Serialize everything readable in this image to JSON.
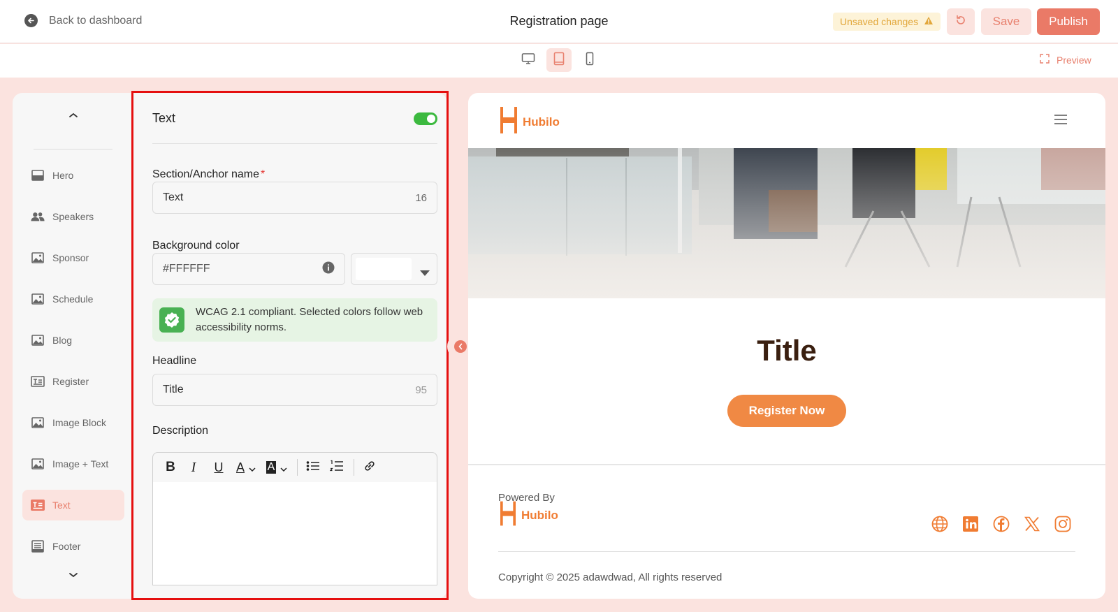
{
  "topbar": {
    "back_label": "Back to dashboard",
    "page_title": "Registration page",
    "unsaved_label": "Unsaved changes",
    "save_label": "Save",
    "publish_label": "Publish"
  },
  "devicebar": {
    "devices": [
      "desktop",
      "tablet",
      "mobile"
    ],
    "active_device": "tablet",
    "preview_label": "Preview"
  },
  "sidebar": {
    "items": [
      {
        "label": "Hero",
        "icon": "hero-section-icon"
      },
      {
        "label": "Speakers",
        "icon": "speakers-icon"
      },
      {
        "label": "Sponsor",
        "icon": "image-icon"
      },
      {
        "label": "Schedule",
        "icon": "image-icon"
      },
      {
        "label": "Blog",
        "icon": "image-icon"
      },
      {
        "label": "Register",
        "icon": "text-block-icon"
      },
      {
        "label": "Image Block",
        "icon": "image-icon"
      },
      {
        "label": "Image + Text",
        "icon": "image-icon"
      },
      {
        "label": "Text",
        "icon": "text-block-icon",
        "active": true
      },
      {
        "label": "Footer",
        "icon": "footer-icon"
      }
    ]
  },
  "editor": {
    "title": "Text",
    "enabled": true,
    "anchor_label": "Section/Anchor name",
    "anchor_required": "*",
    "anchor_value": "Text",
    "anchor_count": "16",
    "bg_label": "Background color",
    "bg_value": "#FFFFFF",
    "wcag_message": "WCAG 2.1 compliant. Selected colors follow web accessibility norms.",
    "headline_label": "Headline",
    "headline_value": "Title",
    "headline_count": "95",
    "description_label": "Description",
    "toolbar": {
      "bold": "B",
      "italic": "I",
      "underline": "U",
      "font_color": "A",
      "highlight": "A"
    }
  },
  "canvas": {
    "brand_name": "Hubilo",
    "section_title": "Title",
    "register_label": "Register Now",
    "powered_by": "Powered By",
    "footer_brand": "Hubilo",
    "socials": [
      "globe-icon",
      "linkedin-icon",
      "facebook-icon",
      "x-icon",
      "instagram-icon"
    ],
    "copyright": "Copyright © 2025 adawdwad, All rights reserved"
  },
  "colors": {
    "accent": "#ea7a67",
    "brand_orange": "#f07c32",
    "background": "#fbe3df",
    "toggle_on": "#3cb93f"
  }
}
